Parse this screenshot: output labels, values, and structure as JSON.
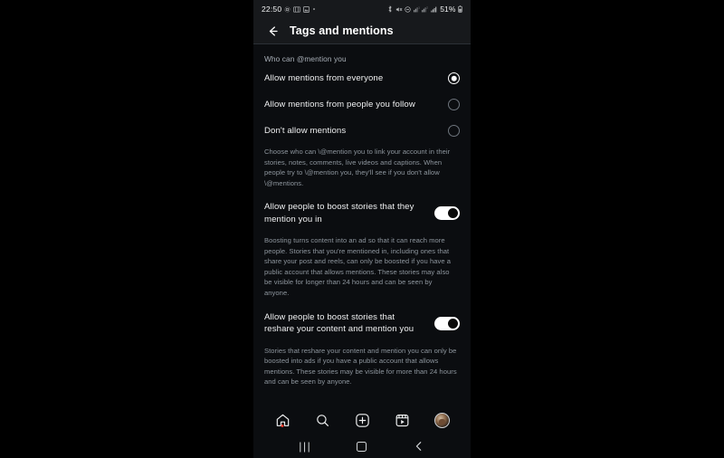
{
  "status_bar": {
    "time": "22:50",
    "battery_text": "51%",
    "left_icons": [
      "settings-gear-icon",
      "photos-icon",
      "image-icon",
      "dot-icon"
    ],
    "right_icons": [
      "bluetooth-icon",
      "mute-icon",
      "dnd-icon",
      "sim1-signal-icon",
      "sim2-signal-icon",
      "wifi-signal-icon"
    ]
  },
  "header": {
    "back_icon": "back-arrow-icon",
    "title": "Tags and mentions"
  },
  "section": {
    "label": "Who can @mention you",
    "options": [
      {
        "label": "Allow mentions from everyone",
        "selected": true
      },
      {
        "label": "Allow mentions from people you follow",
        "selected": false
      },
      {
        "label": "Don't allow mentions",
        "selected": false
      }
    ],
    "description": "Choose who can \\@mention you to link your account in their stories, notes, comments, live videos and captions. When people try to \\@mention you, they'll see if you don't allow \\@mentions."
  },
  "toggles": [
    {
      "label": "Allow people to boost stories that they mention you in",
      "state": "on",
      "description": "Boosting turns content into an ad so that it can reach more people. Stories that you're mentioned in, including ones that share your post and reels, can only be boosted if you have a public account that allows mentions. These stories may also be visible for longer than 24 hours and can be seen by anyone."
    },
    {
      "label": "Allow people to boost stories that reshare your content and mention you",
      "state": "on",
      "description": "Stories that reshare your content and mention you can only be boosted into ads if you have a public account that allows mentions. These stories may be visible for more than 24 hours and can be seen by anyone."
    }
  ],
  "tab_bar": {
    "items": [
      {
        "icon": "home-icon",
        "badge": true
      },
      {
        "icon": "search-icon",
        "badge": false
      },
      {
        "icon": "add-post-icon",
        "badge": false
      },
      {
        "icon": "reels-icon",
        "badge": false
      },
      {
        "icon": "profile-avatar",
        "badge": false
      }
    ]
  },
  "nav_bar": {
    "recents": "|||",
    "home": "home-square-icon",
    "back": "back-chevron-icon"
  },
  "colors": {
    "background": "#000000",
    "phone_bg": "#0b0d10",
    "header_bg": "#17191c",
    "primary_text": "#f0f1f2",
    "secondary_text": "#8d959d",
    "accent_white": "#ffffff",
    "badge_red": "#e8392a"
  }
}
